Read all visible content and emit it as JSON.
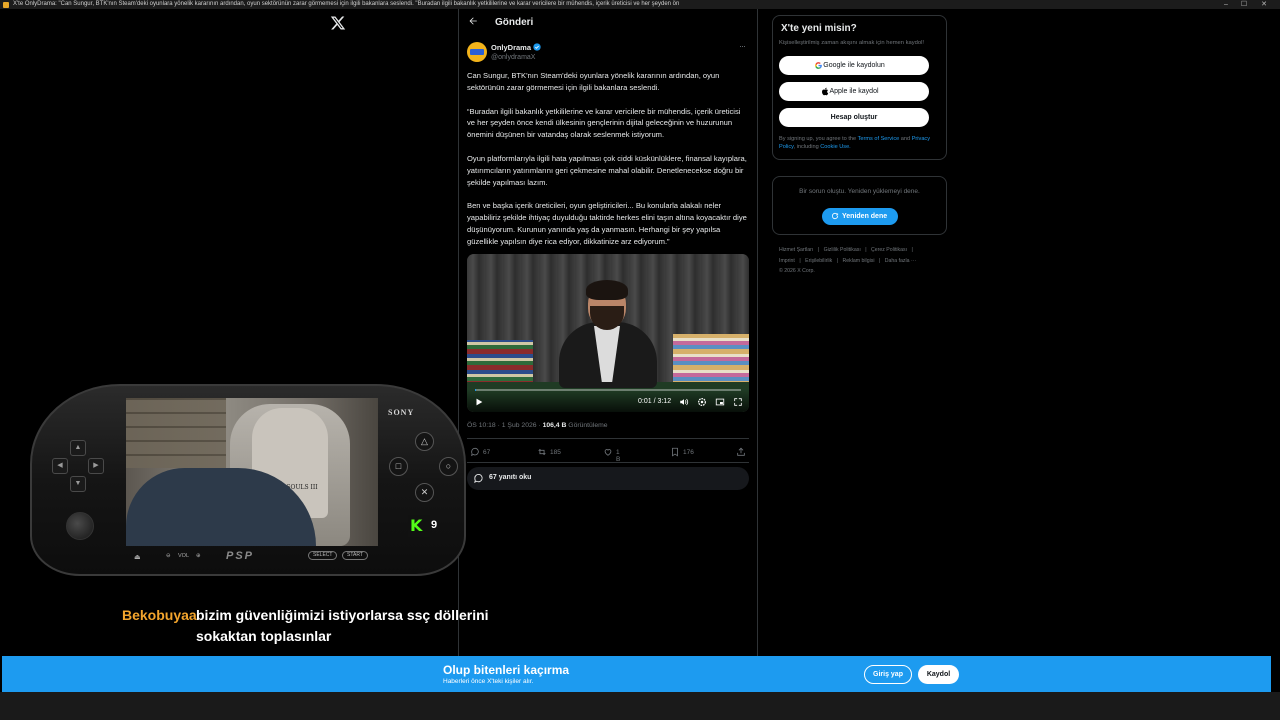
{
  "window": {
    "title": "X'te OnlyDrama: \"Can Sungur, BTK'nın Steam'deki oyunlara yönelik kararının ardından, oyun sektörünün zarar görmemesi için ilgili bakanlara seslendi. \"Buradan ilgili bakanlık yetkililerine ve karar vericilere bir mühendis, içerik üreticisi ve her şeyden ön",
    "controls": [
      "–",
      "☐",
      "✕"
    ]
  },
  "header": {
    "title": "Gönderi"
  },
  "tweet": {
    "author_name": "OnlyDrama",
    "author_handle": "@onlydramaX",
    "paragraphs": [
      "Can Sungur, BTK'nın Steam'deki oyunlara yönelik kararının ardından, oyun sektörünün zarar görmemesi için ilgili bakanlara seslendi.",
      "“Buradan ilgili bakanlık yetkililerine ve karar vericilere bir mühendis, içerik üreticisi ve her şeyden önce kendi ülkesinin gençlerinin dijital geleceğinin ve huzurunun önemini düşünen bir vatandaş olarak seslenmek istiyorum.",
      "Oyun platformlarıyla ilgili hata yapılması çok ciddi küskünlüklere, finansal kayıplara, yatırımcıların yatırımlarını geri çekmesine mahal olabilir. Denetlenecekse doğru bir şekilde yapılması lazım.",
      "Ben ve başka içerik üreticileri, oyun geliştiricileri... Bu konularla alakalı neler yapabiliriz şekilde ihtiyaç duyulduğu taktirde herkes elini taşın altına koyacaktır diye düşünüyorum. Kurunun yanında yaş da yanmasın. Herhangi bir şey yapılsa güzellikle yapılsın diye rica ediyor, dikkatinize arz ediyorum.”"
    ],
    "video": {
      "time": "0:01 / 3:12",
      "progress": 0.005
    },
    "meta_time": "ÖS 10:18 · 1 Şub 2026 · ",
    "meta_views": "106,4 B",
    "meta_views_label": " Görüntüleme",
    "actions": {
      "replies": "67",
      "reposts": "185",
      "likes": "1 B",
      "bookmarks": "176"
    },
    "read_replies": "67 yanıtı oku"
  },
  "sidebar": {
    "signup_title": "X'te yeni misin?",
    "signup_sub": "Kişiselleştirilmiş zaman akışını almak için hemen kaydol!",
    "google_btn": "Google ile kaydolun",
    "apple_btn": "Apple ile kaydol",
    "create_btn": "Hesap oluştur",
    "terms_pre": "By signing up, you agree to the ",
    "terms_link1": "Terms of Service",
    "terms_mid": " and ",
    "terms_link2": "Privacy Policy",
    "terms_mid2": ", including ",
    "terms_link3": "Cookie Use.",
    "error_text": "Bir sorun oluştu. Yeniden yüklemeyi dene.",
    "retry_btn": "Yeniden dene",
    "footer_links": [
      "Hizmet Şartları",
      "|",
      "Gizlilik Politikası",
      "|",
      "Çerez Politikası",
      "|",
      "Imprint",
      "|",
      "Erişilebilirlik",
      "|",
      "Reklam bilgisi",
      "|",
      "Daha fazla ···",
      "© 2026 X Corp."
    ]
  },
  "overlay": {
    "psp_brand": "SONY",
    "psp_logo": "PSP",
    "psp_vol": "VOL",
    "psp_select": "SELECT",
    "psp_start": "START",
    "chair_text": "DARK SOULS III",
    "kick_letter": "K",
    "kick_count": "9",
    "chat_user": "Bekobuyaa",
    "chat_line1": "bizim güvenliğimizi istiyorlarsa ssç döllerini",
    "chat_line2": "sokaktan toplasınlar"
  },
  "banner": {
    "title": "Olup bitenleri kaçırma",
    "subtitle": "Haberleri önce X'teki kişiler alır.",
    "login": "Giriş yap",
    "signup": "Kaydol"
  },
  "colors": {
    "accent": "#1d9bf0",
    "chat_user": "#f3a52d",
    "kick_green": "#53fc18"
  }
}
